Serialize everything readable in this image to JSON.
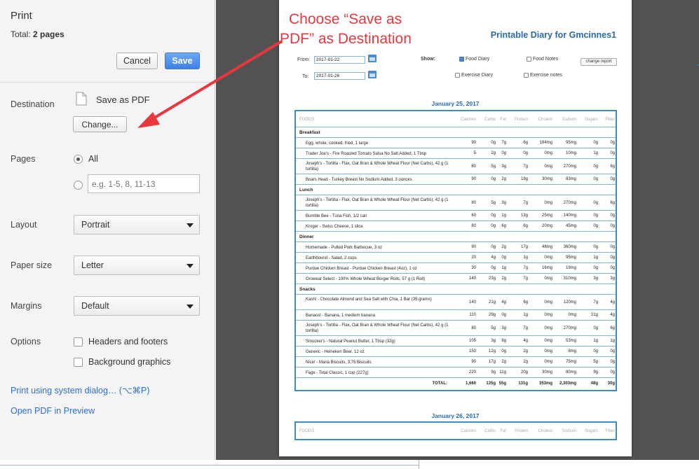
{
  "print_panel": {
    "title": "Print",
    "total_label": "Total:",
    "total_value": "2 pages",
    "cancel_label": "Cancel",
    "save_label": "Save",
    "destination_label": "Destination",
    "destination_value": "Save as PDF",
    "change_label": "Change...",
    "pages_label": "Pages",
    "pages_all": "All",
    "pages_placeholder": "e.g. 1-5, 8, 11-13",
    "layout_label": "Layout",
    "layout_value": "Portrait",
    "paper_label": "Paper size",
    "paper_value": "Letter",
    "margins_label": "Margins",
    "margins_value": "Default",
    "options_label": "Options",
    "opt_headers": "Headers and footers",
    "opt_background": "Background graphics",
    "system_dialog_link": "Print using system dialog… (⌥⌘P)",
    "open_pdf_link": "Open PDF in Preview"
  },
  "annotation": {
    "line1": "Choose “Save as",
    "line2": "PDF” as Destination",
    "color": "#e8373d"
  },
  "report": {
    "title": "Printable Diary for Gmcinnes1",
    "from_label": "From:",
    "from_value": "2017-01-22",
    "to_label": "To:",
    "to_value": "2017-01-26",
    "show_label": "Show:",
    "food_diary": "Food Diary",
    "food_notes": "Food Notes",
    "exercise_diary": "Exercise Diary",
    "exercise_notes": "Exercise notes",
    "change_report": "change report",
    "columns": [
      "FOODS",
      "Calories",
      "Carbs",
      "Fat",
      "Protein",
      "Cholest",
      "Sodium",
      "Sugars",
      "Fiber"
    ],
    "day1": "January 25, 2017",
    "day2": "January 26, 2017",
    "sections": [
      {
        "name": "Breakfast",
        "rows": [
          [
            "Egg, whole, cooked, fried, 1 large",
            "90",
            "0g",
            "7g",
            "6g",
            "184mg",
            "95mg",
            "0g",
            "0g"
          ],
          [
            "Trader Joe's - Fire Roasted Tomato Salsa No Salt Added, 1 Tbsp",
            "5",
            "2g",
            "0g",
            "0g",
            "0mg",
            "10mg",
            "1g",
            "0g"
          ],
          [
            "Joseph's - Tortilla - Flax, Oat Bran & Whole Wheat Flour (Net Carbs), 42 g (1 tortilla)",
            "80",
            "5g",
            "3g",
            "7g",
            "0mg",
            "270mg",
            "0g",
            "6g"
          ],
          [
            "Boars Head - Turkey Breast No Sodium Added, 3 ounces",
            "90",
            "0g",
            "2g",
            "18g",
            "30mg",
            "83mg",
            "0g",
            "0g"
          ]
        ]
      },
      {
        "name": "Lunch",
        "rows": [
          [
            "Joseph's - Tortilla - Flax, Oat Bran & Whole Wheat Flour (Net Carbs), 42 g (1 tortilla)",
            "80",
            "5g",
            "3g",
            "7g",
            "0mg",
            "270mg",
            "0g",
            "6g"
          ],
          [
            "Bumble Bee - Tuna Fish, 1/2 can",
            "60",
            "0g",
            "1g",
            "13g",
            "25mg",
            "140mg",
            "0g",
            "0g"
          ],
          [
            "Kroger - Swiss Cheese, 1 slice",
            "80",
            "0g",
            "6g",
            "6g",
            "20mg",
            "45mg",
            "0g",
            "0g"
          ]
        ]
      },
      {
        "name": "Dinner",
        "rows": [
          [
            "Homemade - Pulled Pork Barbecue, 3 oz",
            "90",
            "0g",
            "2g",
            "17g",
            "48mg",
            "360mg",
            "0g",
            "0g"
          ],
          [
            "Earthbound - Salad, 2 cups",
            "20",
            "4g",
            "0g",
            "1g",
            "0mg",
            "95mg",
            "1g",
            "0g"
          ],
          [
            "Purdue Chicken Breast - Purdue Chicken Breast (4oz), 1 oz",
            "30",
            "0g",
            "1g",
            "7g",
            "16mg",
            "19mg",
            "0g",
            "0g"
          ],
          [
            "Oroweat Select - 100% Whole Wheat Burger Rolls, 57 g (1 Roll)",
            "140",
            "23g",
            "2g",
            "7g",
            "0mg",
            "310mg",
            "3g",
            "3g"
          ]
        ]
      },
      {
        "name": "Snacks",
        "rows": [
          [
            "Kashi - Chocolate Almond and Sea Salt with Chia, 1 Bar (35 grams)",
            "140",
            "21g",
            "4g",
            "6g",
            "0mg",
            "120mg",
            "7g",
            "4g"
          ],
          [
            "Banacol - Banana, 1 medium banana",
            "110",
            "29g",
            "0g",
            "1g",
            "0mg",
            "0mg",
            "21g",
            "4g"
          ],
          [
            "Joseph's - Tortilla - Flax, Oat Bran & Whole Wheat Flour (Net Carbs), 42 g (1 tortilla)",
            "80",
            "5g",
            "3g",
            "7g",
            "0mg",
            "270mg",
            "0g",
            "6g"
          ],
          [
            "Smucker's - Natural Peanut Butter, 1 Tbsp (32g)",
            "105",
            "3g",
            "8g",
            "4g",
            "0mg",
            "53mg",
            "1g",
            "1g"
          ],
          [
            "Generic - Heineken Beer, 12 oz",
            "150",
            "12g",
            "0g",
            "2g",
            "0mg",
            "8mg",
            "0g",
            "0g"
          ],
          [
            "Nice! - Maria Biscuits, 3.75 Biscuits",
            "90",
            "17g",
            "2g",
            "2g",
            "0mg",
            "75mg",
            "5g",
            "0g"
          ],
          [
            "Fage - Total Classic, 1 cup (227g)",
            "220",
            "9g",
            "11g",
            "20g",
            "30mg",
            "80mg",
            "9g",
            "0g"
          ]
        ]
      }
    ],
    "total_row": [
      "TOTAL:",
      "1,660",
      "135g",
      "55g",
      "131g",
      "353mg",
      "2,303mg",
      "48g",
      "30g"
    ]
  }
}
